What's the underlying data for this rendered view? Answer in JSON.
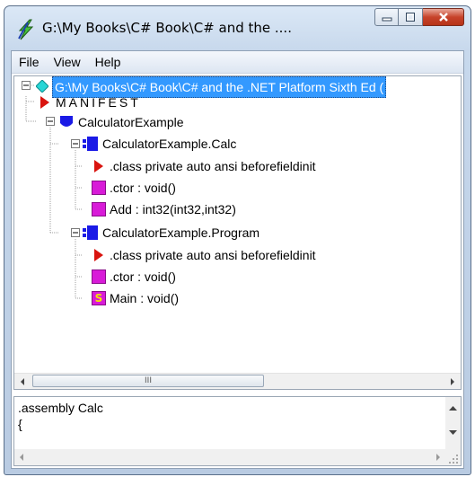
{
  "window": {
    "title": "G:\\My Books\\C# Book\\C# and the ...."
  },
  "menu": {
    "items": [
      "File",
      "View",
      "Help"
    ]
  },
  "tree": {
    "root_label": "G:\\My Books\\C# Book\\C# and the .NET Platform Sixth Ed (",
    "manifest_label": "MANIFEST",
    "namespace_label": "CalculatorExample",
    "calc_class_label": "CalculatorExample.Calc",
    "calc_directive_label": ".class private auto ansi beforefieldinit",
    "calc_ctor_label": ".ctor : void()",
    "calc_add_label": "Add : int32(int32,int32)",
    "program_class_label": "CalculatorExample.Program",
    "program_directive_label": ".class private auto ansi beforefieldinit",
    "program_ctor_label": ".ctor : void()",
    "program_main_label": "Main : void()",
    "static_badge": "S"
  },
  "il_view": {
    "line1": ".assembly Calc",
    "line2": "{"
  },
  "scroll": {
    "thumb_grip": "III"
  },
  "colors": {
    "selection": "#3399ff",
    "method_icon": "#d81bd8",
    "class_icon": "#1a1ae6",
    "namespace_icon": "#1a1ae6",
    "manifest_icon": "#d9140f",
    "root_icon": "#28d6d6"
  }
}
